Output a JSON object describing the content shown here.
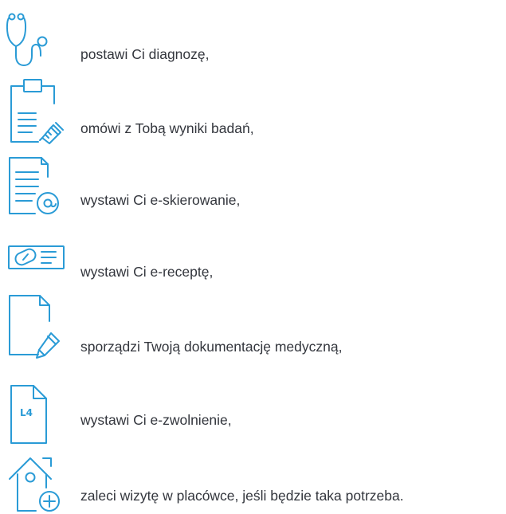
{
  "accent_color": "#2a9bd6",
  "text_color": "#33363d",
  "items": [
    {
      "icon": "stethoscope-icon",
      "label": "postawi Ci diagnozę,"
    },
    {
      "icon": "clipboard-syringe-icon",
      "label": "omówi z Tobą wyniki badań,"
    },
    {
      "icon": "document-email-icon",
      "label": "wystawi Ci e-skierowanie,"
    },
    {
      "icon": "prescription-card-icon",
      "label": "wystawi Ci e-receptę,"
    },
    {
      "icon": "document-pencil-icon",
      "label": "sporządzi Twoją dokumentację medyczną,"
    },
    {
      "icon": "sick-leave-document-icon",
      "label": "wystawi Ci e-zwolnienie,"
    },
    {
      "icon": "clinic-visit-icon",
      "label": "zaleci wizytę w placówce, jeśli będzie taka potrzeba."
    }
  ],
  "icons": {
    "l4_text": "L4"
  }
}
